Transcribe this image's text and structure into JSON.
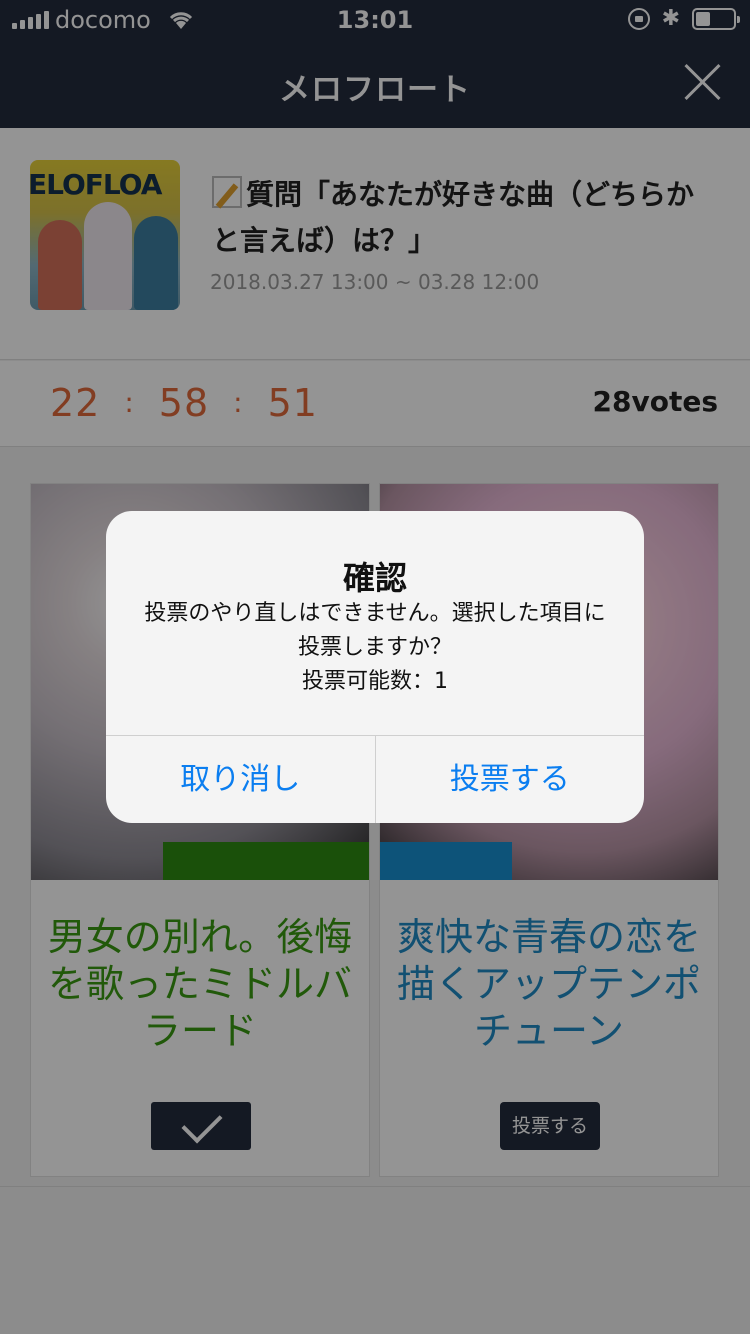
{
  "status_bar": {
    "carrier": "docomo",
    "time": "13:01"
  },
  "nav": {
    "title": "メロフロート"
  },
  "question": {
    "thumb_text": "ELOFLOA",
    "title": "質問「あなたが好きな曲（どちらかと言えば）は？」",
    "period": "2018.03.27 13:00 ~ 03.28 12:00"
  },
  "timer": {
    "hours": "22",
    "minutes": "58",
    "seconds": "51",
    "separator": ":",
    "votes": "28votes"
  },
  "choices": [
    {
      "text": "男女の別れ。後悔を歌ったミドルバラード",
      "color": "#3a9a12",
      "bar_color": "#2e8b12",
      "status": "voted"
    },
    {
      "text": "爽快な青春の恋を描くアップテンポチューン",
      "color": "#1f8bc4",
      "bar_color": "#178fd1",
      "vote_label": "投票する"
    }
  ],
  "dialog": {
    "title": "確認",
    "message_line1": "投票のやり直しはできません。選択した項目に投票しますか？",
    "message_line2": "投票可能数：1",
    "cancel_label": "取り消し",
    "confirm_label": "投票する"
  },
  "colors": {
    "nav_bg": "#242b3d",
    "timer": "#e06a3c",
    "accent_blue": "#0b7ef0"
  }
}
